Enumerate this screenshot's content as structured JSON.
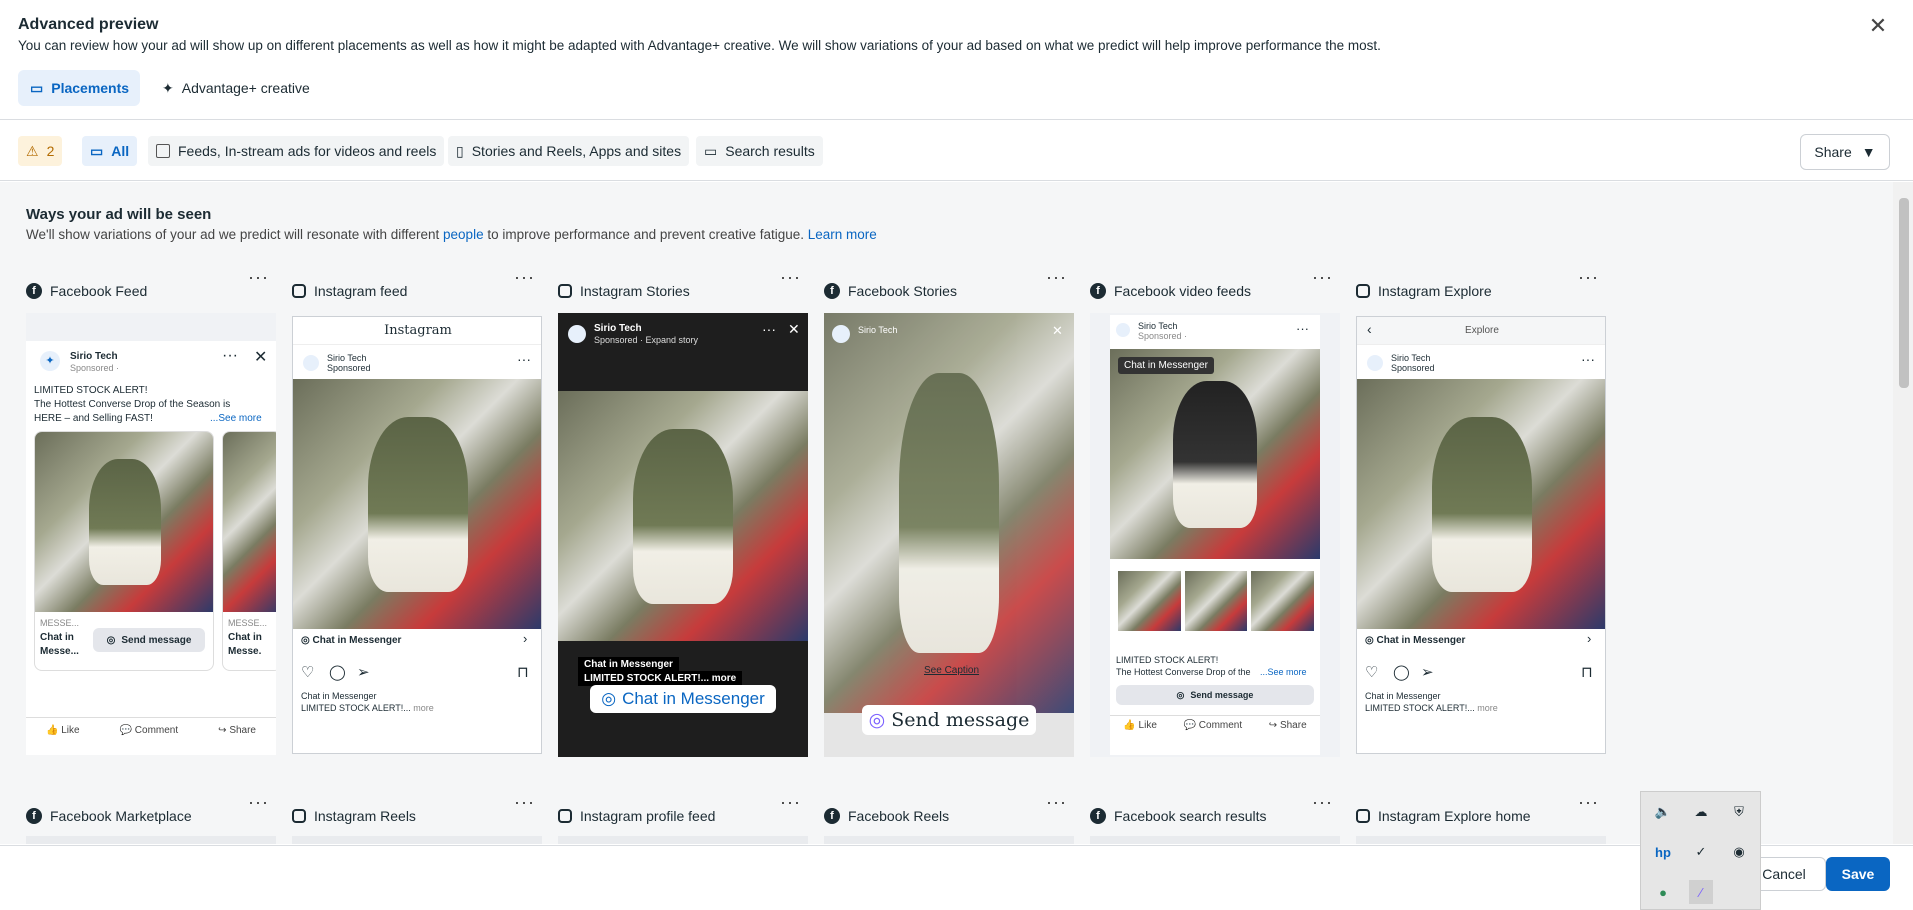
{
  "header": {
    "title": "Advanced preview",
    "subtitle": "You can review how your ad will show up on different placements as well as how it might be adapted with Advantage+ creative. We will show variations of your ad based on what we predict will help improve performance the most.",
    "tabs": [
      {
        "label": "Placements"
      },
      {
        "label": "Advantage+ creative"
      }
    ]
  },
  "filters": {
    "warning_count": "2",
    "all": "All",
    "options": [
      {
        "label": "Feeds, In-stream ads for videos and reels"
      },
      {
        "label": "Stories and Reels, Apps and sites"
      },
      {
        "label": "Search results"
      }
    ],
    "share": "Share"
  },
  "section": {
    "title": "Ways your ad will be seen",
    "desc_pre": "We'll show variations of your ad we predict will resonate with different ",
    "desc_link": "people",
    "desc_post": " to improve performance and prevent creative fatigue. ",
    "learn_more": "Learn more"
  },
  "placements_row1": [
    {
      "name": "Facebook Feed",
      "platform": "facebook"
    },
    {
      "name": "Instagram feed",
      "platform": "instagram"
    },
    {
      "name": "Instagram Stories",
      "platform": "instagram"
    },
    {
      "name": "Facebook Stories",
      "platform": "facebook"
    },
    {
      "name": "Facebook video feeds",
      "platform": "facebook"
    },
    {
      "name": "Instagram Explore",
      "platform": "instagram"
    }
  ],
  "placements_row2": [
    {
      "name": "Facebook Marketplace",
      "platform": "facebook"
    },
    {
      "name": "Instagram Reels",
      "platform": "instagram"
    },
    {
      "name": "Instagram profile feed",
      "platform": "instagram"
    },
    {
      "name": "Facebook Reels",
      "platform": "facebook"
    },
    {
      "name": "Facebook search results",
      "platform": "facebook"
    },
    {
      "name": "Instagram Explore home",
      "platform": "instagram"
    }
  ],
  "ad": {
    "page_name": "Sirio Tech",
    "sponsored": "Sponsored",
    "sponsored_dot": "Sponsored · ",
    "expand_story": "Sponsored · Expand story",
    "text_line1": "LIMITED STOCK ALERT!",
    "text_line2": "The Hottest Converse Drop of the Season is",
    "text_line3": "HERE – and Selling FAST!",
    "see_more": "...See more",
    "see_more_short": "...See more",
    "cta_send": "Send message",
    "cta_chat": "Chat in Messenger",
    "messenger_label": "MESSE...",
    "chat_in": "Chat in",
    "messe": "Messe...",
    "messe_dot": "Messe.",
    "instagram_logo": "Instagram",
    "explore": "Explore",
    "caption_chat": "Chat in Messenger",
    "caption_stock": "LIMITED STOCK ALERT!...",
    "more": "more",
    "stock_more": "LIMITED STOCK ALERT!... more",
    "see_caption": "See Caption",
    "video_text": "The Hottest Converse Drop of the",
    "like": "Like",
    "comment": "Comment",
    "share": "Share"
  },
  "footer": {
    "cancel": "Cancel",
    "save": "Save"
  }
}
